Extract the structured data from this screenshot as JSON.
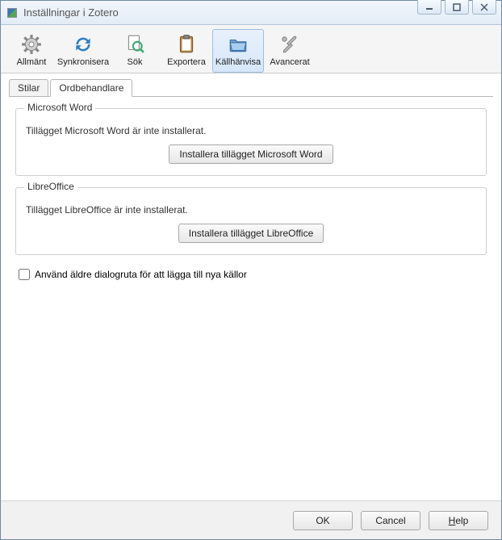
{
  "window": {
    "title": "Inställningar i Zotero"
  },
  "toolbar": {
    "items": [
      {
        "label": "Allmänt"
      },
      {
        "label": "Synkronisera"
      },
      {
        "label": "Sök"
      },
      {
        "label": "Exportera"
      },
      {
        "label": "Källhänvisa"
      },
      {
        "label": "Avancerat"
      }
    ]
  },
  "tabs": {
    "items": [
      {
        "label": "Stilar"
      },
      {
        "label": "Ordbehandlare"
      }
    ]
  },
  "groups": {
    "word": {
      "legend": "Microsoft Word",
      "desc": "Tillägget Microsoft Word är inte installerat.",
      "button": "Installera tillägget Microsoft Word"
    },
    "libre": {
      "legend": "LibreOffice",
      "desc": "Tillägget LibreOffice är inte installerat.",
      "button": "Installera tillägget LibreOffice"
    }
  },
  "checkbox": {
    "label": "Använd äldre dialogruta för att lägga till nya källor"
  },
  "footer": {
    "ok": "OK",
    "cancel": "Cancel",
    "help": "Help"
  }
}
